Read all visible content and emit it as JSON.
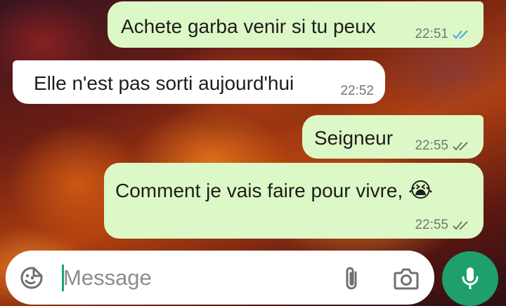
{
  "messages": [
    {
      "direction": "out",
      "text": "Achete garba venir si tu peux",
      "time": "22:51",
      "status": "read"
    },
    {
      "direction": "in",
      "text": "Elle n'est pas sorti aujourd'hui",
      "time": "22:52"
    },
    {
      "direction": "out",
      "text": "Seigneur",
      "time": "22:55",
      "status": "delivered"
    },
    {
      "direction": "out",
      "text": "Comment je vais faire pour vivre,",
      "emoji": "😭",
      "time": "22:55",
      "status": "delivered"
    }
  ],
  "composer": {
    "placeholder": "Message",
    "emoji_icon": "emoji-icon",
    "attach_icon": "paperclip-icon",
    "camera_icon": "camera-icon",
    "mic_icon": "microphone-icon"
  },
  "colors": {
    "outgoing_bubble": "#dcf8c6",
    "incoming_bubble": "#ffffff",
    "read_tick": "#4aa3df",
    "delivered_tick": "#6b7a6e",
    "mic_button": "#1f9f6b"
  }
}
